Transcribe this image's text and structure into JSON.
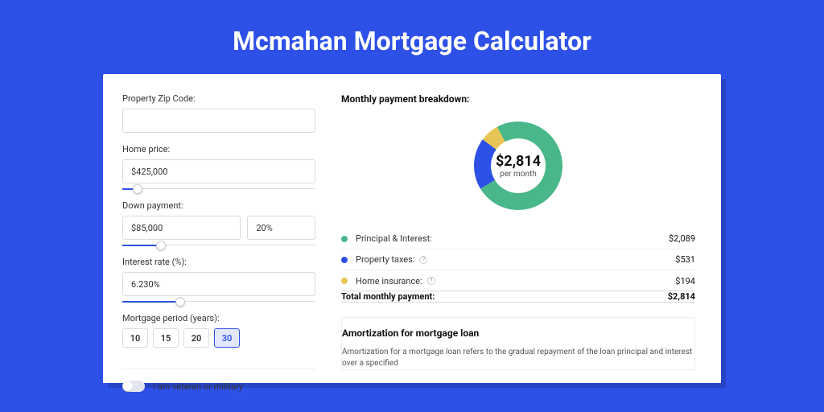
{
  "title": "Mcmahan Mortgage Calculator",
  "form": {
    "zip_label": "Property Zip Code:",
    "zip_value": "",
    "home_price_label": "Home price:",
    "home_price_value": "$425,000",
    "home_price_slider_pct": 8,
    "down_payment_label": "Down payment:",
    "down_payment_amount": "$85,000",
    "down_payment_pct": "20%",
    "down_payment_slider_pct": 20,
    "interest_label": "Interest rate (%):",
    "interest_value": "6.230%",
    "interest_slider_pct": 30,
    "period_label": "Mortgage period (years):",
    "period_options": [
      "10",
      "15",
      "20",
      "30"
    ],
    "period_selected": "30",
    "veteran_label": "I am veteran or military",
    "veteran_on": false
  },
  "breakdown": {
    "title": "Monthly payment breakdown:",
    "center_amount": "$2,814",
    "center_sub": "per month",
    "items": [
      {
        "color": "green",
        "label": "Principal & Interest:",
        "help": false,
        "value": "$2,089"
      },
      {
        "color": "blue",
        "label": "Property taxes:",
        "help": true,
        "value": "$531"
      },
      {
        "color": "yellow",
        "label": "Home insurance:",
        "help": true,
        "value": "$194"
      }
    ],
    "total_label": "Total monthly payment:",
    "total_value": "$2,814"
  },
  "amort": {
    "title": "Amortization for mortgage loan",
    "desc": "Amortization for a mortgage loan refers to the gradual repayment of the loan principal and interest over a specified"
  },
  "chart_data": {
    "type": "pie",
    "title": "Monthly payment breakdown",
    "series": [
      {
        "name": "Principal & Interest",
        "value": 2089,
        "color": "#49b78a"
      },
      {
        "name": "Property taxes",
        "value": 531,
        "color": "#2d50e6"
      },
      {
        "name": "Home insurance",
        "value": 194,
        "color": "#e7c657"
      }
    ],
    "total": 2814,
    "center_label": "$2,814 per month",
    "donut": true
  }
}
